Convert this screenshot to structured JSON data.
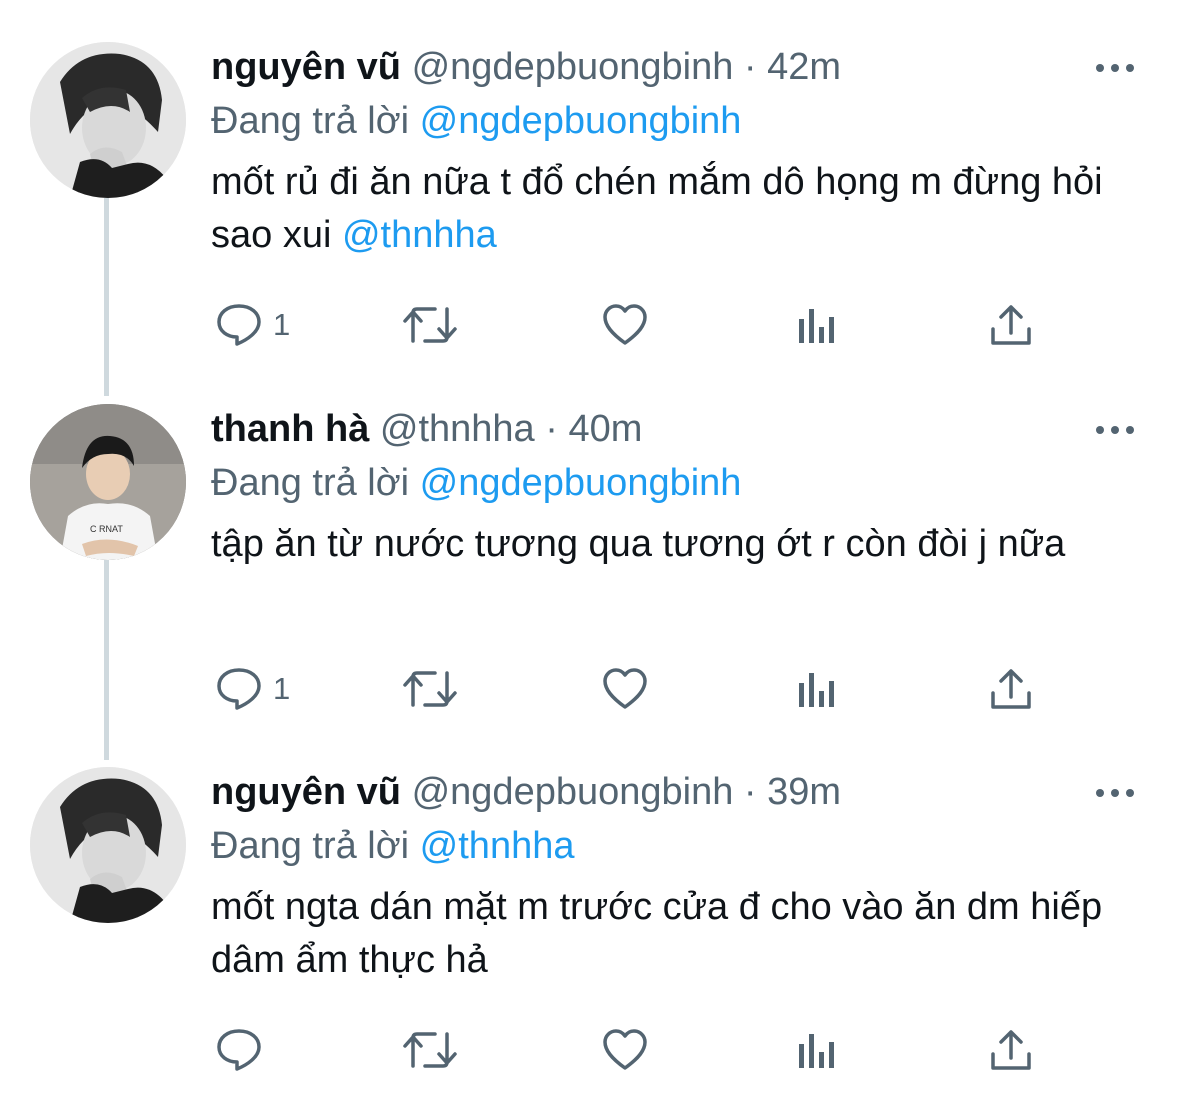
{
  "colors": {
    "text_primary": "#0f1419",
    "text_secondary": "#536471",
    "link": "#1d9bf0",
    "thread_line": "#cfd9de"
  },
  "tweets": [
    {
      "display_name": "nguyên vũ",
      "handle": "@ngdepbuongbinh",
      "separator": "·",
      "time": "42m",
      "replying_prefix": "Đang trả lời",
      "replying_to": "@ngdepbuongbinh",
      "text": "mốt rủ đi ăn nữa t đổ chén mắm dô họng m đừng hỏi sao xui",
      "text_mention": "@thnhha",
      "reply_count": "1",
      "avatar_icon": "avatar-photo-bw"
    },
    {
      "display_name": "thanh hà",
      "handle": "@thnhha",
      "separator": "·",
      "time": "40m",
      "replying_prefix": "Đang trả lời",
      "replying_to": "@ngdepbuongbinh",
      "text": "tập ăn từ nước tương qua tương ớt r còn đòi j nữa",
      "text_mention": "",
      "reply_count": "1",
      "avatar_icon": "avatar-photo-color"
    },
    {
      "display_name": "nguyên vũ",
      "handle": "@ngdepbuongbinh",
      "separator": "·",
      "time": "39m",
      "replying_prefix": "Đang trả lời",
      "replying_to": "@thnhha",
      "text": "mốt ngta dán mặt m trước cửa đ cho vào ăn dm hiếp dâm ẩm thực hả",
      "text_mention": "",
      "reply_count": "",
      "avatar_icon": "avatar-photo-bw"
    }
  ],
  "icons": [
    "reply-icon",
    "retweet-icon",
    "like-icon",
    "analytics-icon",
    "share-icon",
    "more-options-icon"
  ]
}
